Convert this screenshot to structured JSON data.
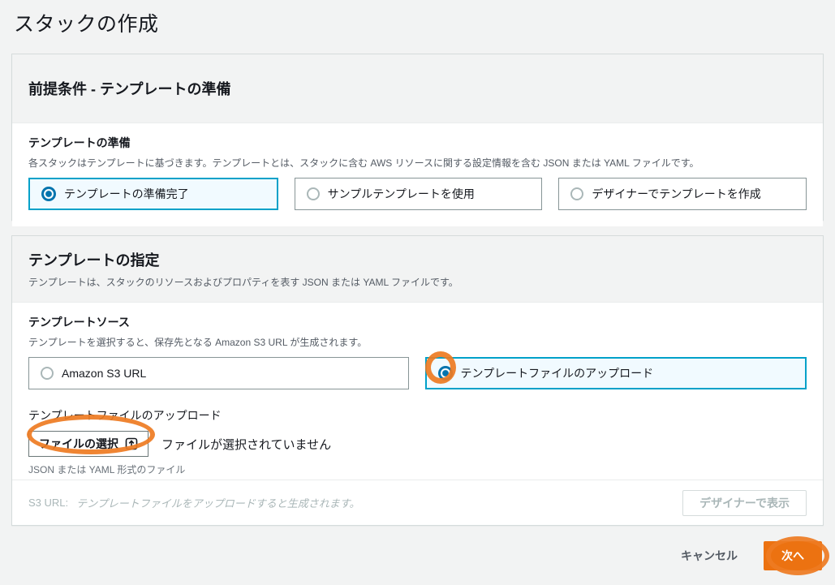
{
  "page": {
    "title": "スタックの作成"
  },
  "colors": {
    "accent_orange": "#ec7211",
    "annotation_orange": "#ee7b22",
    "selected_tile_border": "#00a1c9",
    "selected_tile_bg": "#f1faff",
    "radio_selected_blue": "#0273ad",
    "page_bg": "#f2f3f3"
  },
  "prerequisite_card": {
    "title": "前提条件 - テンプレートの準備",
    "field_label": "テンプレートの準備",
    "field_description": "各スタックはテンプレートに基づきます。テンプレートとは、スタックに含む AWS リソースに関する設定情報を含む JSON または YAML ファイルです。",
    "options": [
      {
        "label": "テンプレートの準備完了",
        "selected": true
      },
      {
        "label": "サンプルテンプレートを使用",
        "selected": false
      },
      {
        "label": "デザイナーでテンプレートを作成",
        "selected": false
      }
    ]
  },
  "template_card": {
    "title": "テンプレートの指定",
    "description": "テンプレートは、スタックのリソースおよびプロパティを表す JSON または YAML ファイルです。",
    "source_label": "テンプレートソース",
    "source_description": "テンプレートを選択すると、保存先となる Amazon S3 URL が生成されます。",
    "source_options": [
      {
        "label": "Amazon S3 URL",
        "selected": false
      },
      {
        "label": "テンプレートファイルのアップロード",
        "selected": true
      }
    ],
    "upload_label": "テンプレートファイルのアップロード",
    "file_button_label": "ファイルの選択",
    "file_status": "ファイルが選択されていません",
    "file_hint": "JSON または YAML 形式のファイル",
    "s3_url_label": "S3 URL:",
    "s3_url_placeholder": "テンプレートファイルをアップロードすると生成されます。",
    "designer_button_label": "デザイナーで表示"
  },
  "footer": {
    "cancel_label": "キャンセル",
    "next_label": "次へ"
  }
}
